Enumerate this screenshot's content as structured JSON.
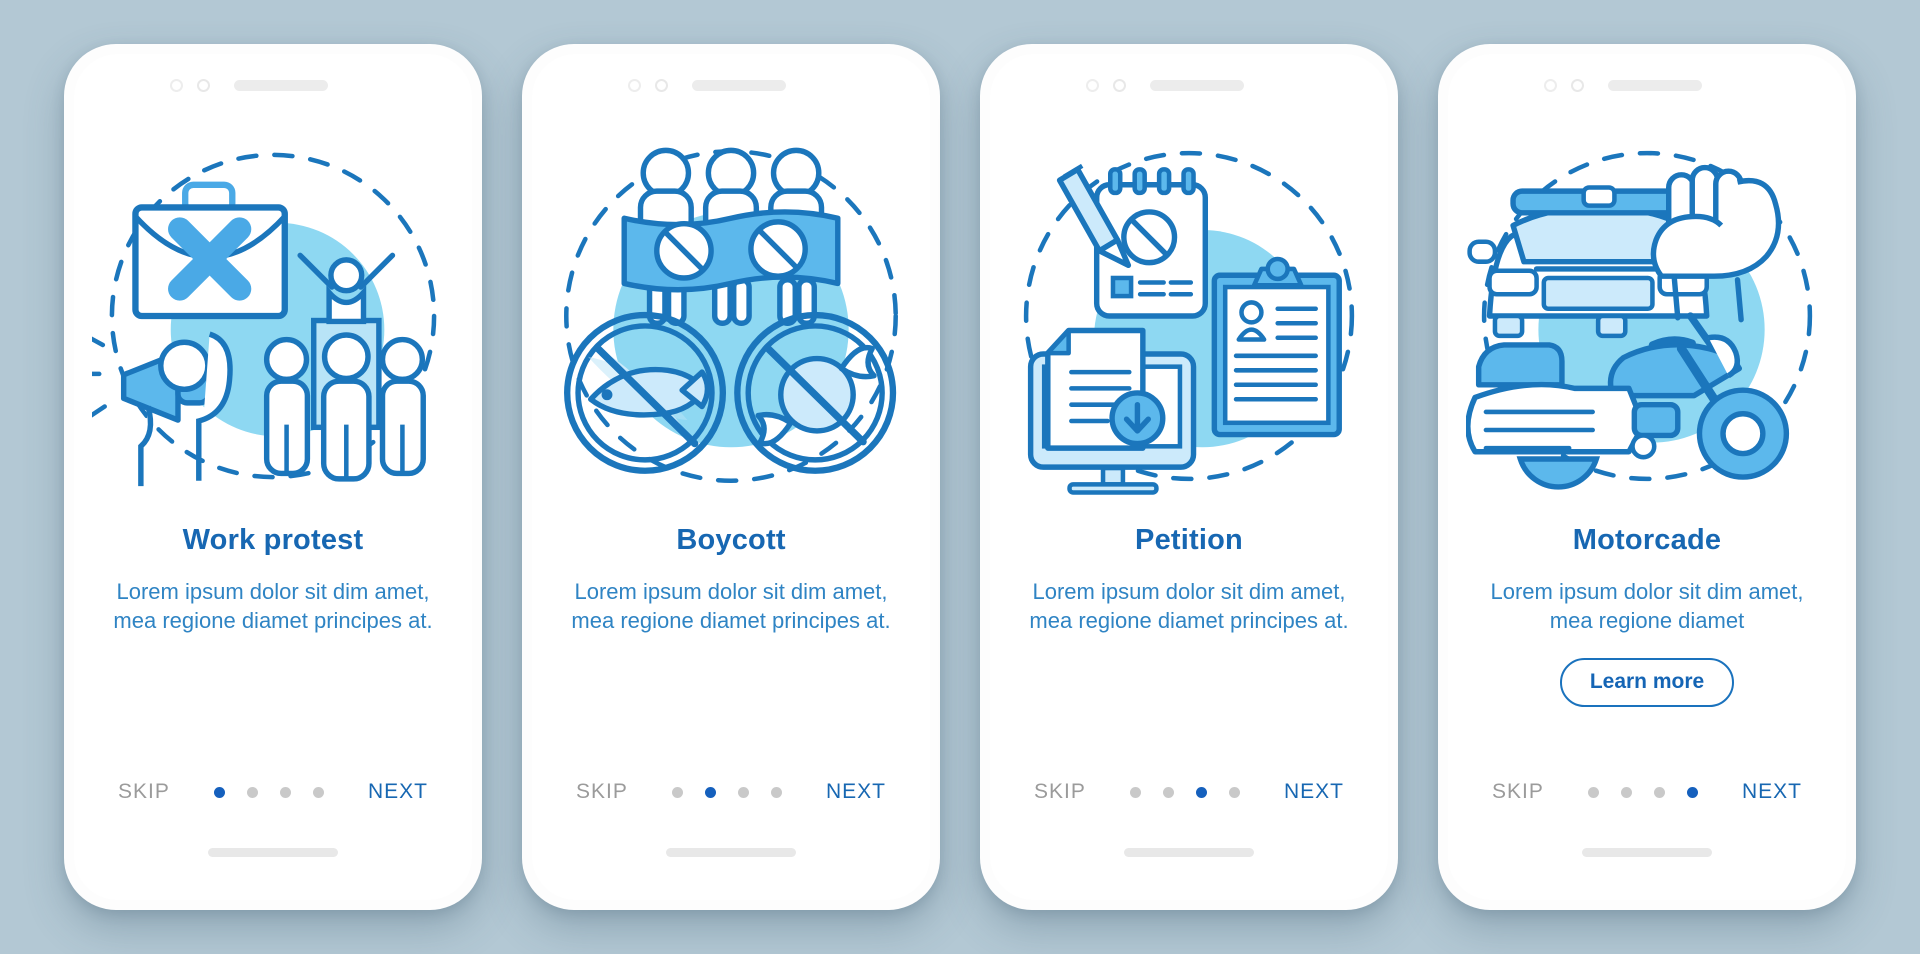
{
  "background_color": "#b3c8d4",
  "colors": {
    "title": "#1767b2",
    "description": "#2f84c4",
    "skip": "#9b9b9b",
    "next": "#1767b2",
    "dot_active": "#1560bd",
    "dot_inactive": "#c9c9c9",
    "art_stroke": "#1b76bc",
    "art_fill_light": "#8ed8f2",
    "art_fill_mid": "#5cb8ec",
    "art_fill_pale": "#cceafb"
  },
  "nav": {
    "skip_label": "SKIP",
    "next_label": "NEXT",
    "dot_count": 4
  },
  "screens": [
    {
      "id": "work-protest",
      "title": "Work protest",
      "description": "Lorem ipsum dolor sit dim amet, mea regione diamet principes at.",
      "active_dot": 1,
      "has_learn_more": false,
      "learn_more_label": "",
      "icon_names": [
        "briefcase-icon",
        "cross-icon",
        "megaphone-icon",
        "crowd-icon",
        "raised-arms-person-icon",
        "dashed-circle-icon"
      ]
    },
    {
      "id": "boycott",
      "title": "Boycott",
      "description": "Lorem ipsum dolor sit dim amet, mea regione diamet principes at.",
      "active_dot": 2,
      "has_learn_more": false,
      "learn_more_label": "",
      "icon_names": [
        "protest-banner-icon",
        "no-fish-icon",
        "no-candy-icon",
        "dashed-circle-icon"
      ]
    },
    {
      "id": "petition",
      "title": "Petition",
      "description": "Lorem ipsum dolor sit dim amet, mea regione diamet principes at.",
      "active_dot": 3,
      "has_learn_more": false,
      "learn_more_label": "",
      "icon_names": [
        "notepad-icon",
        "pencil-icon",
        "monitor-download-icon",
        "clipboard-icon",
        "dashed-circle-icon"
      ]
    },
    {
      "id": "motorcade",
      "title": "Motorcade",
      "description": "Lorem ipsum dolor sit dim amet, mea regione diamet",
      "active_dot": 4,
      "has_learn_more": true,
      "learn_more_label": "Learn more",
      "icon_names": [
        "police-car-icon",
        "raised-fist-icon",
        "motorcycle-icon",
        "dashed-circle-icon"
      ]
    }
  ]
}
